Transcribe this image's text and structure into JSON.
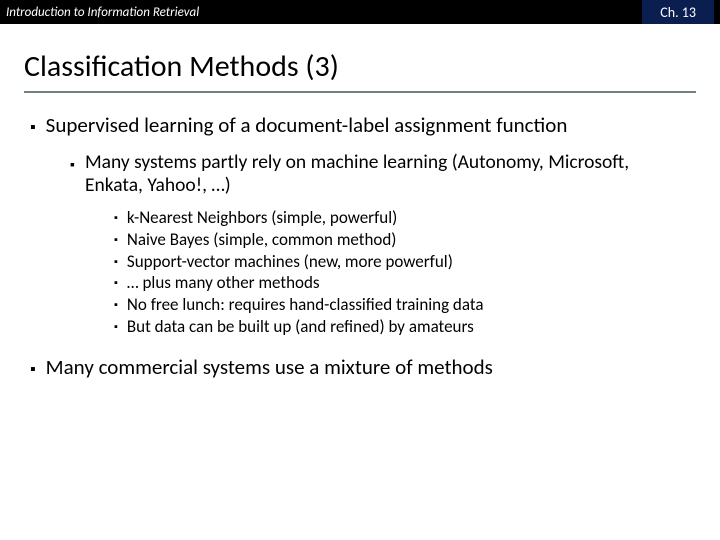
{
  "topbar": {
    "left": "Introduction to Information Retrieval",
    "chapter": "Ch. 13"
  },
  "title": "Classification Methods (3)",
  "bullets": {
    "p1": "Supervised learning of a document-label assignment function",
    "p1_sub": "Many systems partly rely on machine learning (Autonomy, Microsoft, Enkata, Yahoo!, …)",
    "methods": [
      "k-Nearest Neighbors (simple, powerful)",
      "Naive Bayes (simple, common method)",
      "Support-vector machines (new, more powerful)",
      "… plus many other methods",
      "No free lunch: requires hand-classified training data",
      "But data can be built up (and refined) by amateurs"
    ],
    "p2": "Many commercial systems use a mixture of methods"
  }
}
